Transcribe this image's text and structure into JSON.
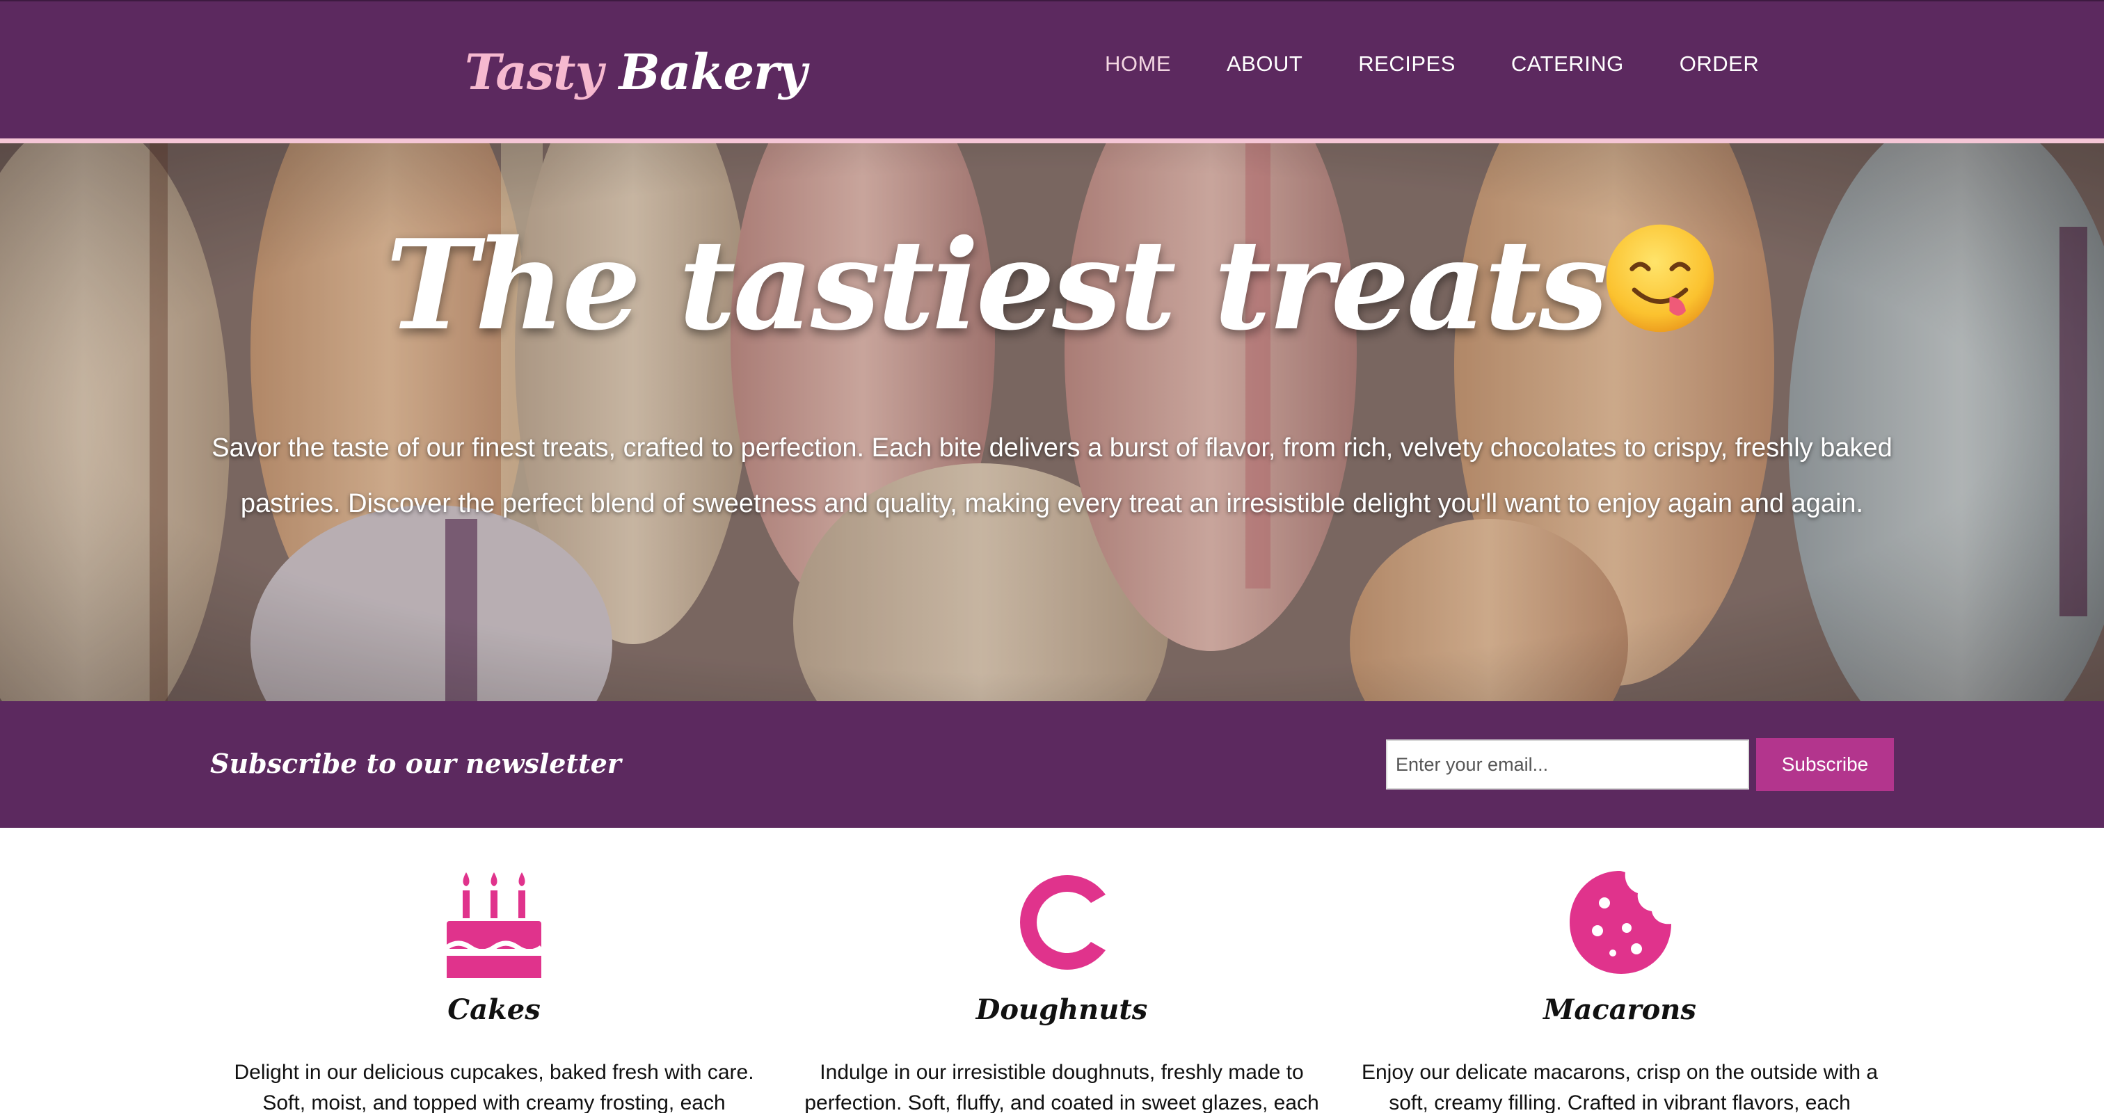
{
  "header": {
    "logo_first": "Tasty",
    "logo_second": "Bakery",
    "nav": [
      "HOME",
      "ABOUT",
      "RECIPES",
      "CATERING",
      "ORDER"
    ]
  },
  "hero": {
    "title": "The tastiest treats",
    "emoji_icon": "face-savoring-food-icon",
    "text": "Savor the taste of our finest treats, crafted to perfection. Each bite delivers a burst of flavor, from rich, velvety chocolates to crispy, freshly baked pastries. Discover the perfect blend of sweetness and quality, making every treat an irresistible delight you'll want to enjoy again and again."
  },
  "newsletter": {
    "title": "Subscribe to our newsletter",
    "email_placeholder": "Enter your email...",
    "button_label": "Subscribe"
  },
  "products": [
    {
      "icon": "birthday-cake-icon",
      "title": "Cakes",
      "text": "Delight in our delicious cupcakes, baked fresh with care. Soft, moist, and topped with creamy frosting, each"
    },
    {
      "icon": "doughnut-icon",
      "title": "Doughnuts",
      "text": "Indulge in our irresistible doughnuts, freshly made to perfection. Soft, fluffy, and coated in sweet glazes, each"
    },
    {
      "icon": "cookie-icon",
      "title": "Macarons",
      "text": "Enjoy our delicate macarons, crisp on the outside with a soft, creamy filling. Crafted in vibrant flavors, each"
    }
  ],
  "colors": {
    "brand_purple": "#5c295f",
    "accent_pink": "#e0338c",
    "button_pink": "#b3358d",
    "logo_pink": "#f6b9cf"
  }
}
